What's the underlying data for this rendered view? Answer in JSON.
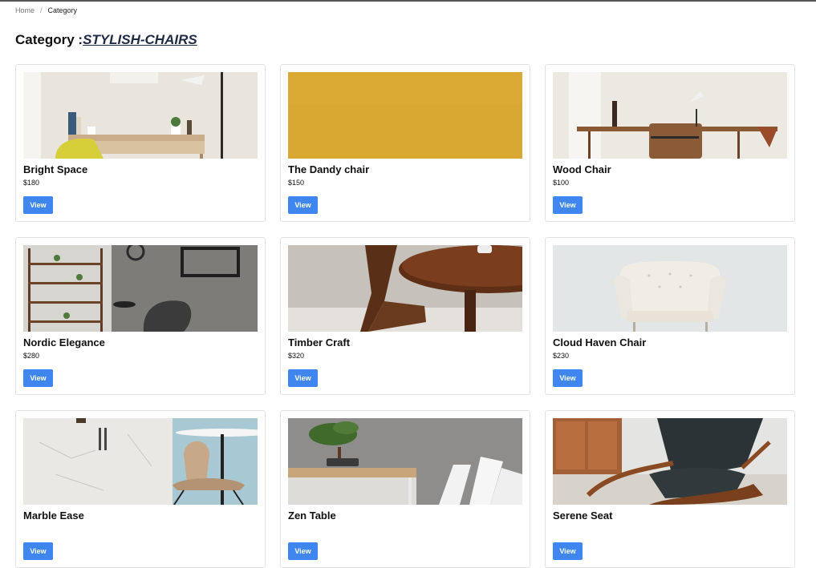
{
  "breadcrumb": {
    "home": "Home",
    "separator": "/",
    "current": "Category"
  },
  "page": {
    "title_prefix": "Category :",
    "category": "STYLISH-CHAIRS"
  },
  "products": [
    {
      "name": "Bright Space",
      "price": "$180",
      "button": "View"
    },
    {
      "name": "The Dandy chair",
      "price": "$150",
      "button": "View"
    },
    {
      "name": "Wood Chair",
      "price": "$100",
      "button": "View"
    },
    {
      "name": "Nordic Elegance",
      "price": "$280",
      "button": "View"
    },
    {
      "name": "Timber Craft",
      "price": "$320",
      "button": "View"
    },
    {
      "name": "Cloud Haven Chair",
      "price": "$230",
      "button": "View"
    },
    {
      "name": "Marble Ease",
      "price": "",
      "button": "View"
    },
    {
      "name": "Zen Table",
      "price": "",
      "button": "View"
    },
    {
      "name": "Serene Seat",
      "price": "",
      "button": "View"
    }
  ],
  "colors": {
    "accent": "#3f86f0",
    "category_link": "#1f2a44"
  }
}
